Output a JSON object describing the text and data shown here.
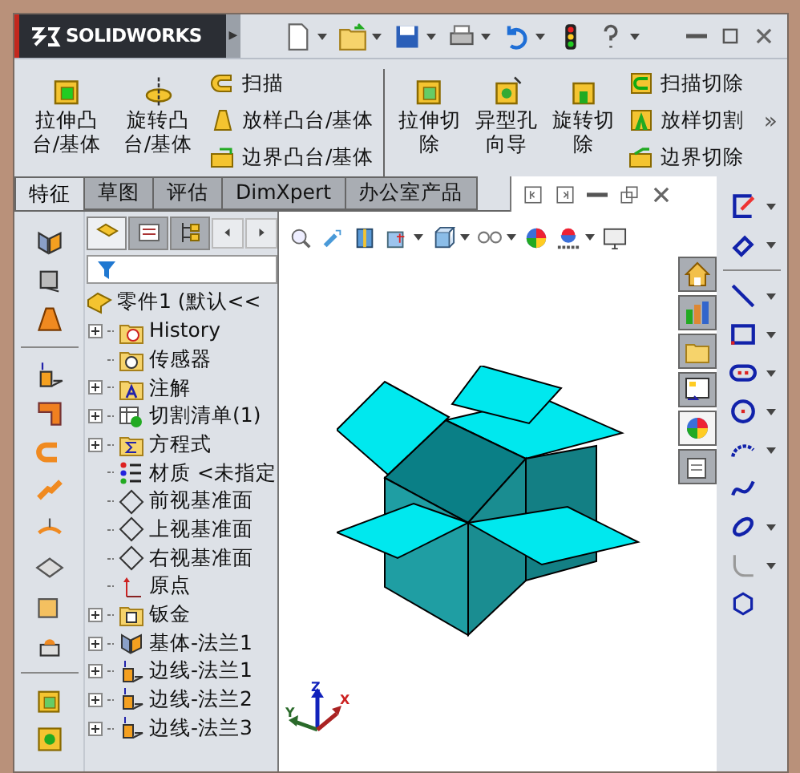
{
  "title_bar": {
    "logo": "SOLIDWORKS",
    "expand": "▶",
    "tools": [
      {
        "kind": "new",
        "dropdown": true
      },
      {
        "kind": "open",
        "dropdown": true
      },
      {
        "kind": "save",
        "dropdown": true
      },
      {
        "kind": "print",
        "dropdown": true
      },
      {
        "kind": "undo",
        "dropdown": true
      },
      {
        "kind": "rebuild",
        "dropdown": false
      },
      {
        "kind": "help",
        "dropdown": true
      }
    ],
    "window_buttons": [
      {
        "kind": "minimize"
      },
      {
        "kind": "maximize"
      },
      {
        "kind": "close"
      }
    ]
  },
  "command_manager": {
    "groups": [
      {
        "large": [
          {
            "label": "拉伸凸台/基体",
            "kind": "extrude"
          },
          {
            "label": "旋转凸台/基体",
            "kind": "revolve"
          }
        ],
        "small": [
          {
            "label": "扫描",
            "kind": "sweep"
          },
          {
            "label": "放样凸台/基体",
            "kind": "loft"
          },
          {
            "label": "边界凸台/基体",
            "kind": "boundary"
          }
        ]
      },
      {
        "large": [
          {
            "label": "拉伸切除",
            "kind": "cut-extrude"
          },
          {
            "label": "异型孔向导",
            "kind": "hole-wizard"
          },
          {
            "label": "旋转切除",
            "kind": "cut-revolve"
          }
        ],
        "small": [
          {
            "label": "扫描切除",
            "kind": "cut-sweep"
          },
          {
            "label": "放样切割",
            "kind": "cut-loft"
          },
          {
            "label": "边界切除",
            "kind": "cut-boundary"
          }
        ]
      }
    ],
    "more": "»"
  },
  "tabs": [
    {
      "label": "特征",
      "selected": true
    },
    {
      "label": "草图",
      "selected": false
    },
    {
      "label": "评估",
      "selected": false
    },
    {
      "label": "DimXpert",
      "selected": false
    },
    {
      "label": "办公室产品",
      "selected": false
    }
  ],
  "left_toolbar": [
    {
      "kind": "base-flange"
    },
    {
      "kind": "convert"
    },
    {
      "kind": "lofted-bend"
    },
    {
      "kind": "divider"
    },
    {
      "kind": "edge-flange"
    },
    {
      "kind": "miter-flange"
    },
    {
      "kind": "hem"
    },
    {
      "kind": "jog"
    },
    {
      "kind": "sketched-bend"
    },
    {
      "kind": "cross-break"
    },
    {
      "kind": "corner"
    },
    {
      "kind": "forming-tool"
    },
    {
      "kind": "divider"
    },
    {
      "kind": "cut-extrude"
    },
    {
      "kind": "hole"
    }
  ],
  "feature_manager": {
    "tabs": [
      {
        "kind": "tree",
        "selected": true
      },
      {
        "kind": "property",
        "selected": false
      },
      {
        "kind": "config",
        "selected": false
      }
    ],
    "nav": [
      {
        "kind": "left"
      },
      {
        "kind": "right"
      }
    ],
    "tree": {
      "label": "零件1  (默认<<",
      "kind": "part",
      "children": [
        {
          "label": "History",
          "kind": "history",
          "collapsed": true
        },
        {
          "label": "传感器",
          "kind": "sensor",
          "collapsed": false
        },
        {
          "label": "注解",
          "kind": "annotation",
          "collapsed": true
        },
        {
          "label": "切割清单(1)",
          "kind": "cutlist",
          "collapsed": true
        },
        {
          "label": "方程式",
          "kind": "equation",
          "collapsed": true
        },
        {
          "label": "材质 <未指定",
          "kind": "material",
          "collapsed": false
        },
        {
          "label": "前视基准面",
          "kind": "plane",
          "collapsed": false
        },
        {
          "label": "上视基准面",
          "kind": "plane",
          "collapsed": false
        },
        {
          "label": "右视基准面",
          "kind": "plane",
          "collapsed": false
        },
        {
          "label": "原点",
          "kind": "origin",
          "collapsed": false
        },
        {
          "label": "钣金",
          "kind": "sheetmetal",
          "collapsed": true
        },
        {
          "label": "基体-法兰1",
          "kind": "base-flange",
          "collapsed": true
        },
        {
          "label": "边线-法兰1",
          "kind": "edge-flange",
          "collapsed": true
        },
        {
          "label": "边线-法兰2",
          "kind": "edge-flange",
          "collapsed": true
        },
        {
          "label": "边线-法兰3",
          "kind": "edge-flange",
          "collapsed": true
        }
      ]
    }
  },
  "viewport": {
    "window_buttons": [
      {
        "kind": "tile-left"
      },
      {
        "kind": "tile-right"
      },
      {
        "kind": "minimize"
      },
      {
        "kind": "restore"
      },
      {
        "kind": "close"
      }
    ],
    "view_toolbar": [
      {
        "kind": "zoom",
        "dropdown": false
      },
      {
        "kind": "previous",
        "dropdown": false
      },
      {
        "kind": "section",
        "dropdown": false
      },
      {
        "kind": "orientation",
        "dropdown": true
      },
      {
        "kind": "display",
        "dropdown": true
      },
      {
        "kind": "hide-show",
        "dropdown": true
      },
      {
        "kind": "appearance",
        "dropdown": false
      },
      {
        "kind": "scene",
        "dropdown": true
      },
      {
        "kind": "view-settings",
        "dropdown": false
      }
    ],
    "triad": {
      "x": "X",
      "y": "Y",
      "z": "Z"
    }
  },
  "task_pane": [
    {
      "kind": "home",
      "selected": false
    },
    {
      "kind": "library",
      "selected": false
    },
    {
      "kind": "explorer",
      "selected": false
    },
    {
      "kind": "palette",
      "selected": false
    },
    {
      "kind": "appearance",
      "selected": true
    },
    {
      "kind": "notes",
      "selected": false
    }
  ],
  "right_toolbar": [
    {
      "kind": "sketch",
      "dropdown": true
    },
    {
      "kind": "dimension",
      "dropdown": true
    },
    {
      "kind": "divider"
    },
    {
      "kind": "line",
      "dropdown": true
    },
    {
      "kind": "rectangle",
      "dropdown": true
    },
    {
      "kind": "slot",
      "dropdown": true
    },
    {
      "kind": "circle",
      "dropdown": true
    },
    {
      "kind": "arc",
      "dropdown": true
    },
    {
      "kind": "spline",
      "dropdown": false
    },
    {
      "kind": "ellipse",
      "dropdown": true
    },
    {
      "kind": "fillet",
      "dropdown": true
    },
    {
      "kind": "polygon",
      "dropdown": false
    }
  ]
}
